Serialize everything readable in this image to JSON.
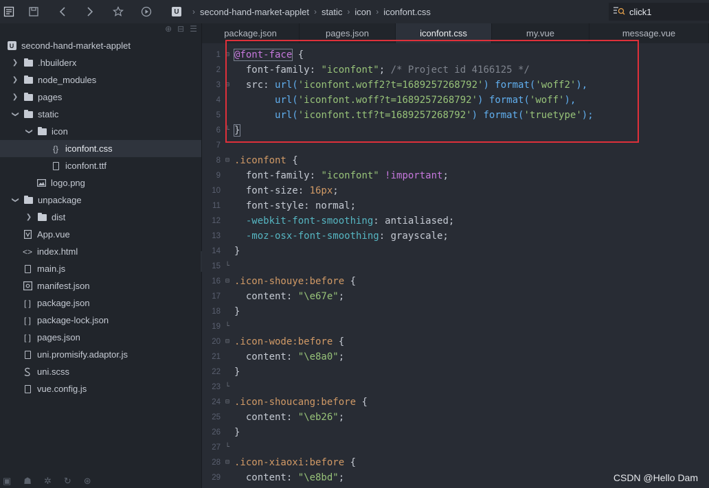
{
  "toolbar": {
    "icons": [
      "new-file-icon",
      "save-icon",
      "back-icon",
      "forward-icon",
      "star-icon",
      "run-icon"
    ]
  },
  "breadcrumb": {
    "project": "second-hand-market-applet",
    "folder1": "static",
    "folder2": "icon",
    "file": "iconfont.css"
  },
  "search": {
    "value": "click1"
  },
  "sidebar": {
    "project_name": "second-hand-market-applet",
    "items": [
      {
        "label": ".hbuilderx"
      },
      {
        "label": "node_modules"
      },
      {
        "label": "pages"
      },
      {
        "label": "static"
      },
      {
        "label": "icon"
      },
      {
        "label": "iconfont.css"
      },
      {
        "label": "iconfont.ttf"
      },
      {
        "label": "logo.png"
      },
      {
        "label": "unpackage"
      },
      {
        "label": "dist"
      },
      {
        "label": "App.vue"
      },
      {
        "label": "index.html"
      },
      {
        "label": "main.js"
      },
      {
        "label": "manifest.json"
      },
      {
        "label": "package.json"
      },
      {
        "label": "package-lock.json"
      },
      {
        "label": "pages.json"
      },
      {
        "label": "uni.promisify.adaptor.js"
      },
      {
        "label": "uni.scss"
      },
      {
        "label": "vue.config.js"
      }
    ]
  },
  "tabs": [
    {
      "label": "package.json"
    },
    {
      "label": "pages.json"
    },
    {
      "label": "iconfont.css"
    },
    {
      "label": "my.vue"
    },
    {
      "label": "message.vue"
    }
  ],
  "editor": {
    "line_numbers": [
      "1",
      "2",
      "3",
      "4",
      "5",
      "6",
      "7",
      "8",
      "9",
      "10",
      "11",
      "12",
      "13",
      "14",
      "15",
      "16",
      "17",
      "18",
      "19",
      "20",
      "21",
      "22",
      "23",
      "24",
      "25",
      "26",
      "27",
      "28",
      "29"
    ],
    "c": {
      "l1_at": "@font-face",
      "l1_brace": " {",
      "l2_prop": "  font-family: ",
      "l2_str": "\"iconfont\"",
      "l2_semi": "; ",
      "l2_com": "/* Project id 4166125 */",
      "l3_prop": "  src: ",
      "l3_fn1": "url(",
      "l3_str1": "'iconfont.woff2?t=1689257268792'",
      "l3_fn2": ") format(",
      "l3_str2": "'woff2'",
      "l3_end": "),",
      "l4_pad": "       ",
      "l4_fn1": "url(",
      "l4_str1": "'iconfont.woff?t=1689257268792'",
      "l4_fn2": ") format(",
      "l4_str2": "'woff'",
      "l4_end": "),",
      "l5_pad": "       ",
      "l5_fn1": "url(",
      "l5_str1": "'iconfont.ttf?t=1689257268792'",
      "l5_fn2": ") format(",
      "l5_str2": "'truetype'",
      "l5_end": ");",
      "l6": "}",
      "l8_sel": ".iconfont",
      "l8_brace": " {",
      "l9_prop": "  font-family: ",
      "l9_str": "\"iconfont\"",
      "l9_imp": " !important",
      "l9_semi": ";",
      "l10_prop": "  font-size: ",
      "l10_num": "16px",
      "l10_semi": ";",
      "l11": "  font-style: normal;",
      "l12_prop": "  -webkit-font-smoothing",
      "l12_rest": ": antialiased;",
      "l13_prop": "  -moz-osx-font-smoothing",
      "l13_rest": ": grayscale;",
      "l14": "}",
      "l16_sel": ".icon-shouye:before",
      "l16_brace": " {",
      "l17_prop": "  content: ",
      "l17_str": "\"\\e67e\"",
      "l17_semi": ";",
      "l18": "}",
      "l20_sel": ".icon-wode:before",
      "l20_brace": " {",
      "l21_prop": "  content: ",
      "l21_str": "\"\\e8a0\"",
      "l21_semi": ";",
      "l22": "}",
      "l24_sel": ".icon-shoucang:before",
      "l24_brace": " {",
      "l25_prop": "  content: ",
      "l25_str": "\"\\eb26\"",
      "l25_semi": ";",
      "l26": "}",
      "l28_sel": ".icon-xiaoxi:before",
      "l28_brace": " {",
      "l29_prop": "  content: ",
      "l29_str": "\"\\e8bd\"",
      "l29_semi": ";"
    }
  },
  "watermark": "CSDN @Hello Dam",
  "colors": {
    "highlight_border": "#e0303a",
    "keyword": "#c678dd",
    "string": "#98c379",
    "function": "#61afef",
    "number": "#d19a66"
  }
}
